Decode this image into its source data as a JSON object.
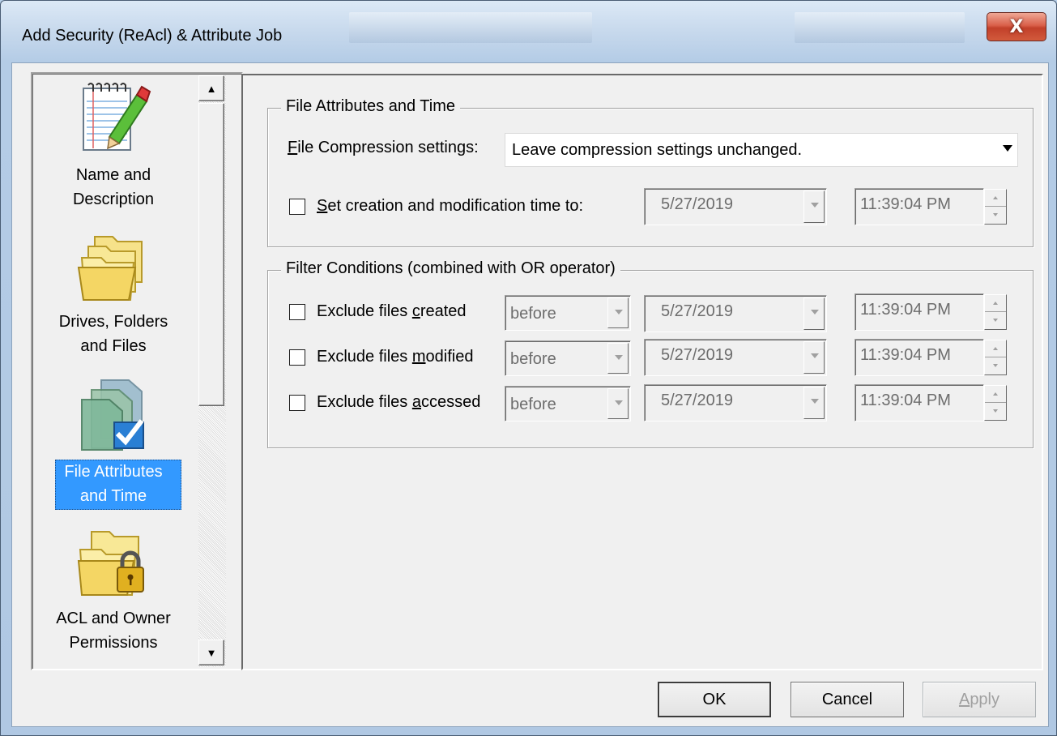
{
  "window": {
    "title": "Add Security (ReAcl) & Attribute Job",
    "close_glyph": "X"
  },
  "nav": {
    "items": [
      {
        "line1": "Name and",
        "line2": "Description",
        "icon": "notepad-pencil-icon"
      },
      {
        "line1": "Drives, Folders",
        "line2": "and Files",
        "icon": "folders-icon"
      },
      {
        "line1": "File Attributes",
        "line2": "and Time",
        "icon": "file-attributes-check-icon",
        "selected": true
      },
      {
        "line1": "ACL and Owner",
        "line2": "Permissions",
        "icon": "folder-lock-icon"
      }
    ],
    "scroll_up": "▲",
    "scroll_down": "▼"
  },
  "attributes_group": {
    "legend": "File Attributes and Time",
    "compression_label_key": "F",
    "compression_label_rest": "ile Compression settings:",
    "compression_value": "Leave compression settings unchanged.",
    "set_time_key": "S",
    "set_time_rest": "et creation and modification time to:",
    "set_time_checked": false,
    "date": "5/27/2019",
    "time": "11:39:04 PM"
  },
  "filter_group": {
    "legend": "Filter Conditions (combined with OR operator)",
    "rows": [
      {
        "pre": "Exclude files ",
        "key": "c",
        "post": "reated",
        "mode": "before",
        "date": "5/27/2019",
        "time": "11:39:04 PM",
        "checked": false
      },
      {
        "pre": "Exclude files ",
        "key": "m",
        "post": "odified",
        "mode": "before",
        "date": "5/27/2019",
        "time": "11:39:04 PM",
        "checked": false
      },
      {
        "pre": "Exclude files ",
        "key": "a",
        "post": "ccessed",
        "mode": "before",
        "date": "5/27/2019",
        "time": "11:39:04 PM",
        "checked": false
      }
    ]
  },
  "buttons": {
    "ok": "OK",
    "cancel": "Cancel",
    "apply_key": "A",
    "apply_rest": "pply"
  }
}
